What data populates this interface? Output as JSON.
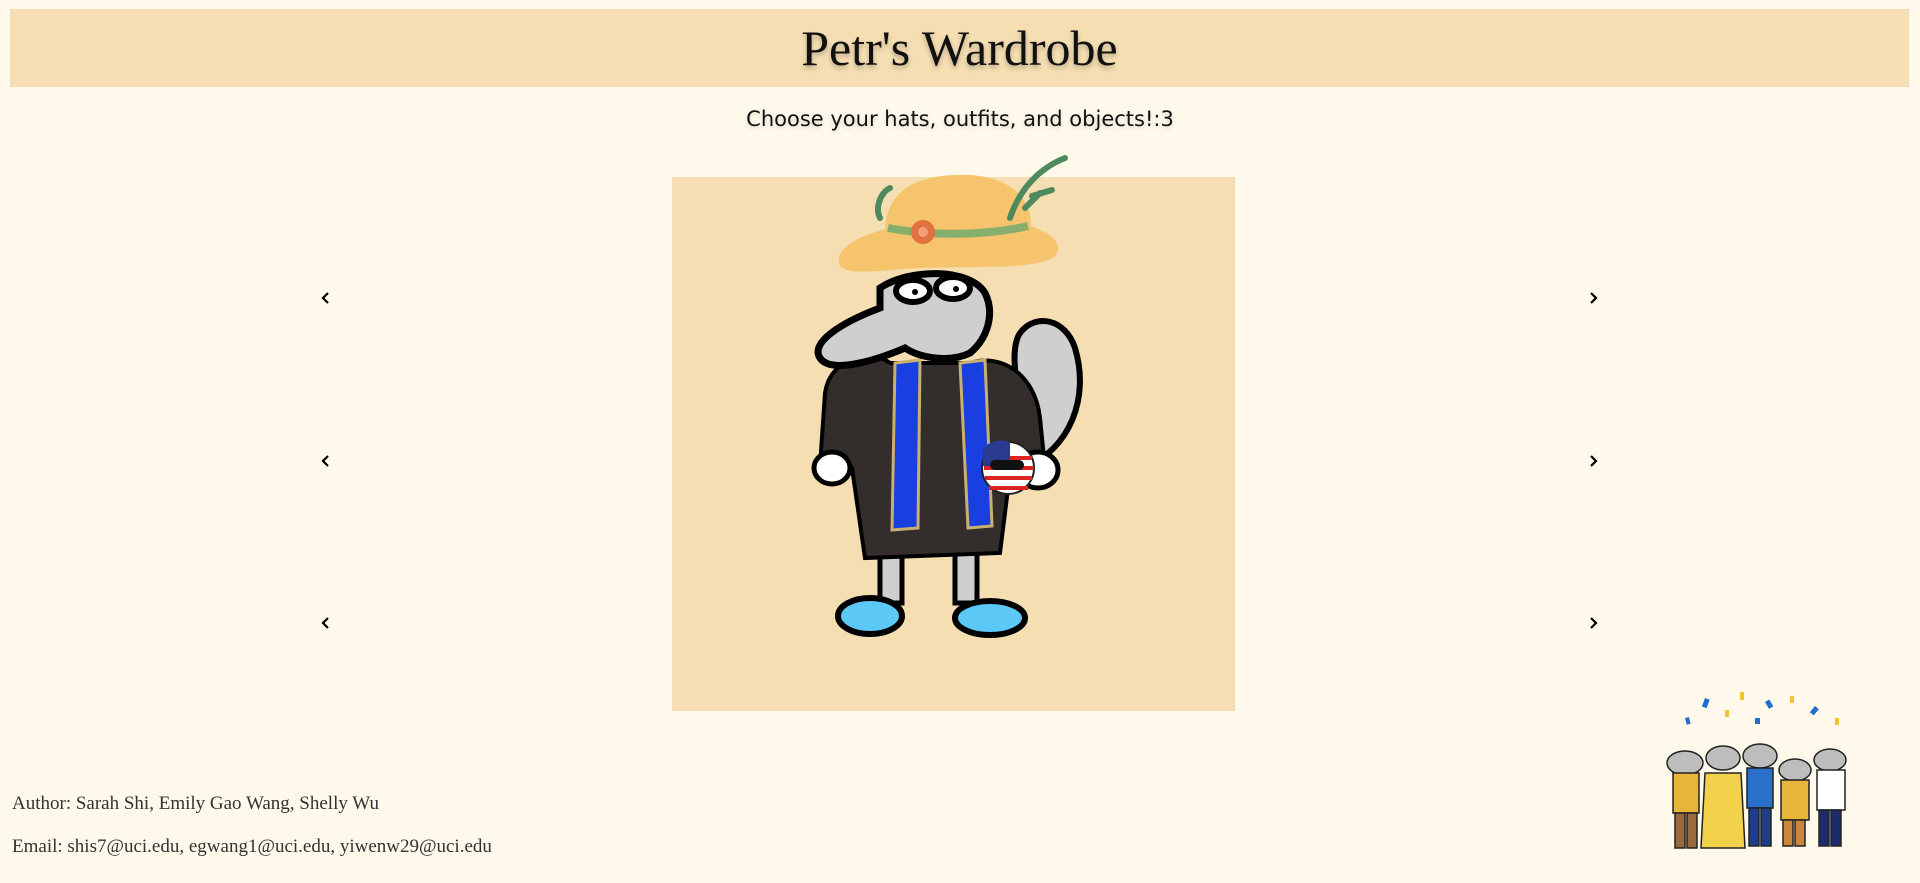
{
  "header": {
    "title": "Petr's Wardrobe"
  },
  "subtitle": "Choose your hats, outfits, and objects!:3",
  "selectors": [
    {
      "row": "hats"
    },
    {
      "row": "outfits"
    },
    {
      "row": "objects"
    }
  ],
  "footer": {
    "author": "Author: Sarah Shi, Emily Gao Wang, Shelly Wu",
    "email": "Email: shis7@uci.edu, egwang1@uci.edu, yiwenw29@uci.edu"
  },
  "colors": {
    "page_bg": "#fff9ec",
    "panel_bg": "#f5deb2",
    "sash_blue": "#1a3fe0",
    "shoe_blue": "#5bc8f5"
  },
  "icons": {
    "prev": "chevron-left-icon",
    "next": "chevron-right-icon"
  }
}
